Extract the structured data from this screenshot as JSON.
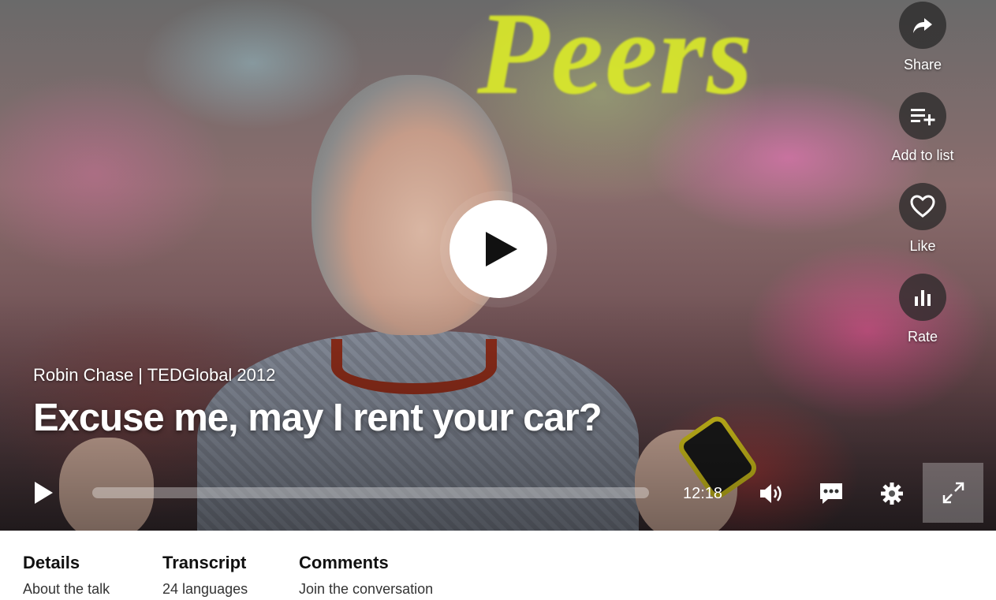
{
  "background_text": "Peers",
  "video": {
    "speaker": "Robin Chase",
    "event": "TEDGlobal 2012",
    "meta_line": "Robin Chase | TEDGlobal 2012",
    "title": "Excuse me, may I rent your car?",
    "duration": "12:18",
    "progress": 0.0
  },
  "actions": [
    {
      "label": "Share",
      "icon": "share-icon"
    },
    {
      "label": "Add to list",
      "icon": "add-to-list-icon"
    },
    {
      "label": "Like",
      "icon": "heart-icon"
    },
    {
      "label": "Rate",
      "icon": "rate-icon"
    }
  ],
  "controls": {
    "icons": [
      "play-icon",
      "volume-icon",
      "subtitles-icon",
      "settings-icon",
      "fullscreen-icon"
    ]
  },
  "tabs": [
    {
      "title": "Details",
      "subtitle": "About the talk"
    },
    {
      "title": "Transcript",
      "subtitle": "24 languages"
    },
    {
      "title": "Comments",
      "subtitle": "Join the conversation"
    }
  ],
  "colors": {
    "accent": "#ffffff",
    "background_text": "#dceb28"
  }
}
